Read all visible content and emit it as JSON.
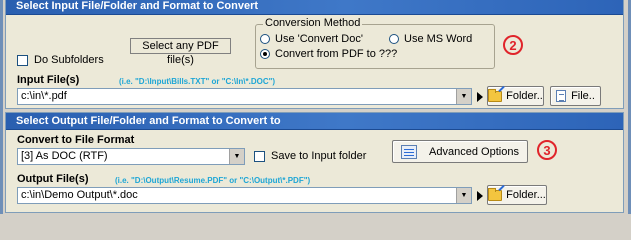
{
  "input_section": {
    "header": "Select Input File/Folder and Format to Convert",
    "do_subfolders_label": "Do Subfolders",
    "file_type_box": "Select any PDF file(s)",
    "conversion_method": {
      "legend": "Conversion Method",
      "options": [
        "Use 'Convert Doc'",
        "Use MS Word",
        "Convert from PDF to ???"
      ],
      "selected": "Convert from PDF to ???"
    },
    "step_number": "2",
    "input_files_label": "Input File(s)",
    "input_files_hint": "(i.e. \"D:\\Input\\Bills.TXT\"  or \"C:\\In\\*.DOC\")",
    "input_value": "c:\\in\\*.pdf",
    "folder_button": "Folder..",
    "file_button": "File.."
  },
  "output_section": {
    "header": "Select Output File/Folder and Format to Convert to",
    "convert_format_label": "Convert to File Format",
    "format_value": "[3] As DOC (RTF)",
    "save_to_input_label": "Save to Input folder",
    "advanced_button": "Advanced Options",
    "step_number": "3",
    "output_files_label": "Output File(s)",
    "output_files_hint": "(i.e. \"D:\\Output\\Resume.PDF\" or \"C:\\Output\\*.PDF\")",
    "output_value": "c:\\in\\Demo Output\\*.doc",
    "folder_button": "Folder..."
  },
  "colors": {
    "header_blue": "#3a71c1",
    "hint_cyan": "#1ea6d6",
    "step_red": "#e0242a"
  }
}
